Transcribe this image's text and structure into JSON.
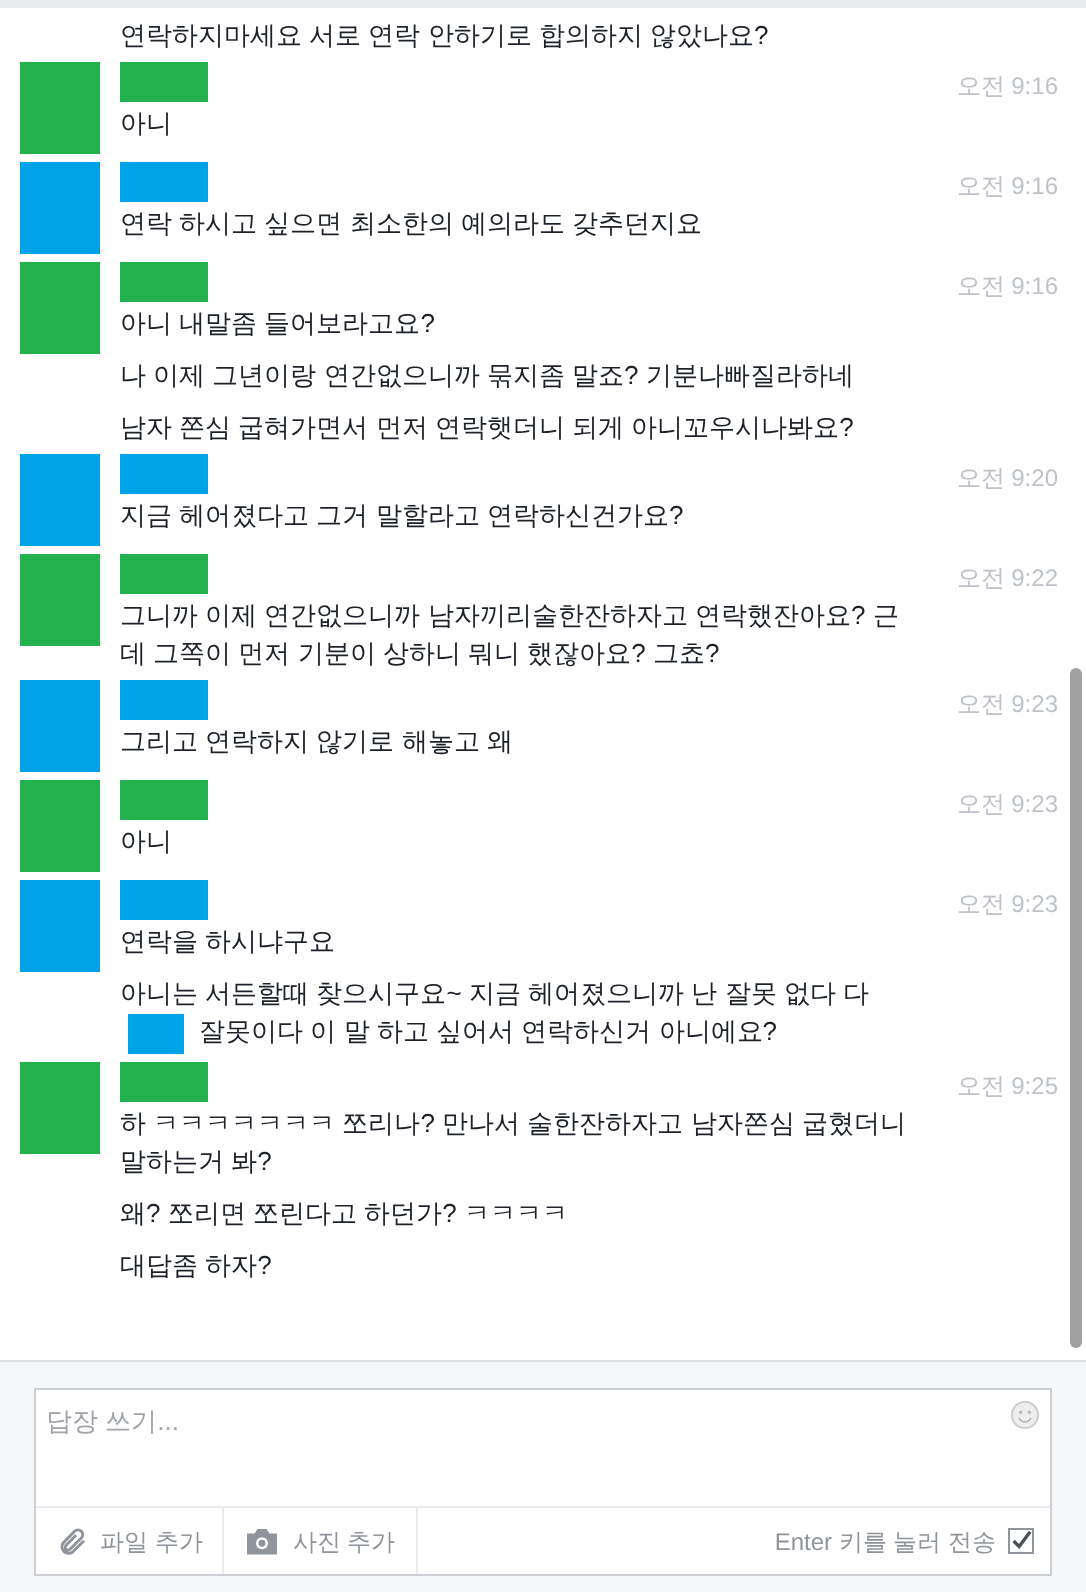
{
  "conversation": [
    {
      "kind": "continued",
      "messages": [
        {
          "text": "연락하지마세요 서로 연락 안하기로 합의하지 않았나요?"
        }
      ]
    },
    {
      "kind": "sender",
      "color": "#22b14c",
      "time": "오전 9:16",
      "messages": [
        {
          "text": "아니"
        }
      ]
    },
    {
      "kind": "sender",
      "color": "#00a2e8",
      "time": "오전 9:16",
      "messages": [
        {
          "text": "연락 하시고 싶으면 최소한의 예의라도 갖추던지요"
        }
      ]
    },
    {
      "kind": "sender",
      "color": "#22b14c",
      "time": "오전 9:16",
      "messages": [
        {
          "text": "아니 내말좀 들어보라고요?"
        },
        {
          "text": "나 이제 그년이랑 연간없으니까 묶지좀 말죠? 기분나빠질라하네"
        },
        {
          "text": "남자 쫀심 굽혀가면서 먼저 연락햇더니 되게 아니꼬우시나봐요?"
        }
      ]
    },
    {
      "kind": "sender",
      "color": "#00a2e8",
      "time": "오전 9:20",
      "messages": [
        {
          "text": "지금 헤어졌다고 그거 말할라고 연락하신건가요?"
        }
      ]
    },
    {
      "kind": "sender",
      "color": "#22b14c",
      "time": "오전 9:22",
      "messages": [
        {
          "text": "그니까 이제 연간없으니까 남자끼리술한잔하자고 연락했잔아요? 근데 그쪽이 먼저 기분이 상하니 뭐니 했잖아요? 그쵸?"
        }
      ]
    },
    {
      "kind": "sender",
      "color": "#00a2e8",
      "time": "오전 9:23",
      "messages": [
        {
          "text": "그리고 연락하지 않기로 해놓고 왜"
        }
      ]
    },
    {
      "kind": "sender",
      "color": "#22b14c",
      "time": "오전 9:23",
      "messages": [
        {
          "text": "아니"
        }
      ]
    },
    {
      "kind": "sender",
      "color": "#00a2e8",
      "time": "오전 9:23",
      "messages": [
        {
          "text": "연락을 하시냐구요"
        },
        {
          "text": "아니는 서든할때 찾으시구요~ 지금 헤어졌으니까 난 잘못 없다 다",
          "color": "#00a2e8",
          "text_after": "잘못이다 이 말 하고 싶어서 연락하신거 아니에요?"
        }
      ]
    },
    {
      "kind": "sender",
      "color": "#22b14c",
      "time": "오전 9:25",
      "messages": [
        {
          "text": "하 ㅋㅋㅋㅋㅋㅋㅋ 쪼리나? 만나서 술한잔하자고 남자쫀심 굽혔더니 말하는거 봐?"
        },
        {
          "text": "왜? 쪼리면 쪼린다고 하던가? ㅋㅋㅋㅋ"
        },
        {
          "text": "대답좀 하자?"
        }
      ]
    }
  ],
  "compose": {
    "placeholder": "답장 쓰기...",
    "actions": [
      {
        "kind": "file",
        "label": "파일 추가"
      },
      {
        "kind": "photo",
        "label": "사진 추가"
      }
    ],
    "send_on_enter": {
      "label": "Enter 키를 눌러 전송",
      "checked": true
    }
  }
}
